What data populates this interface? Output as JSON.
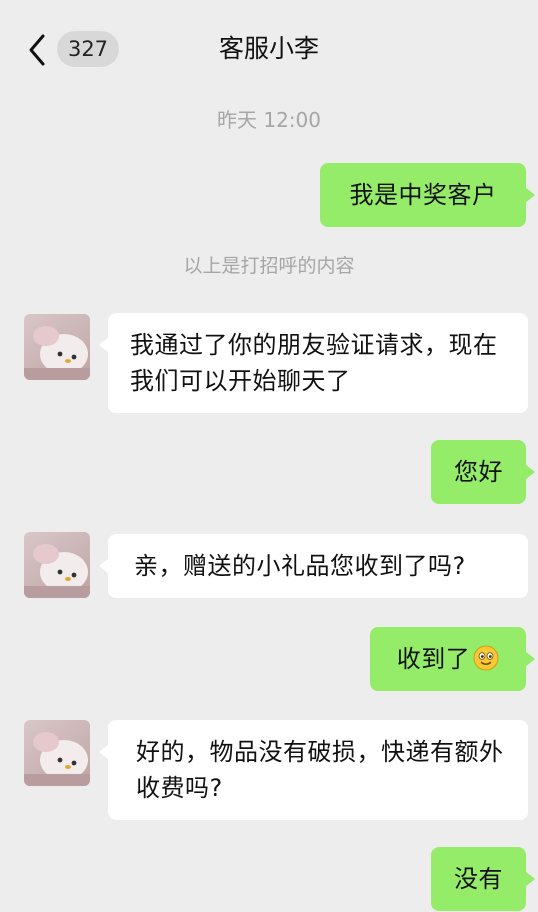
{
  "header": {
    "title": "客服小李",
    "unread_count": "327",
    "back_icon": "chevron-left-icon"
  },
  "chat": {
    "time_label": "昨天 12:00",
    "system_note": "以上是打招呼的内容",
    "messages": [
      {
        "sender": "me",
        "text": "我是中奖客户"
      },
      {
        "sender": "contact",
        "text": "我通过了你的朋友验证请求，现在我们可以开始聊天了"
      },
      {
        "sender": "me",
        "text": "您好"
      },
      {
        "sender": "contact",
        "text": "亲，赠送的小礼品您收到了吗?"
      },
      {
        "sender": "me",
        "text": "收到了",
        "emoji": "smile-emoji-icon"
      },
      {
        "sender": "contact",
        "text": "好的，物品没有破损，快递有额外收费吗?"
      },
      {
        "sender": "me",
        "text": "没有"
      }
    ]
  },
  "colors": {
    "background": "#ededed",
    "outgoing_bubble": "#95ec69",
    "incoming_bubble": "#ffffff",
    "meta_text": "#a6a6a6",
    "badge": "#d8d8d8"
  }
}
